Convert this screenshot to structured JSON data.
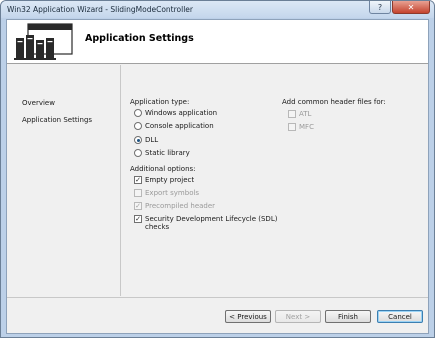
{
  "window": {
    "title": "Win32 Application Wizard - SlidingModeController",
    "help_glyph": "?",
    "close_glyph": "✕"
  },
  "banner": {
    "title": "Application Settings",
    "icon": "wizard-computers-icon"
  },
  "nav": {
    "items": [
      {
        "label": "Overview"
      },
      {
        "label": "Application Settings"
      }
    ]
  },
  "application_type": {
    "label": "Application type:",
    "options": [
      {
        "label": "Windows application",
        "selected": false
      },
      {
        "label": "Console application",
        "selected": false
      },
      {
        "label": "DLL",
        "selected": true
      },
      {
        "label": "Static library",
        "selected": false
      }
    ]
  },
  "additional_options": {
    "label": "Additional options:",
    "options": [
      {
        "label": "Empty project",
        "checked": true,
        "enabled": true
      },
      {
        "label": "Export symbols",
        "checked": false,
        "enabled": false
      },
      {
        "label": "Precompiled header",
        "checked": true,
        "enabled": false
      },
      {
        "label": "Security Development Lifecycle (SDL)",
        "label_line2": "checks",
        "checked": true,
        "enabled": true
      }
    ]
  },
  "common_headers": {
    "label": "Add common header files for:",
    "options": [
      {
        "label": "ATL",
        "checked": false,
        "enabled": false
      },
      {
        "label": "MFC",
        "checked": false,
        "enabled": false
      }
    ]
  },
  "buttons": {
    "previous": "< Previous",
    "next": "Next >",
    "finish": "Finish",
    "cancel": "Cancel"
  },
  "colors": {
    "frame": "#bcd0e8",
    "close_button": "#c4432e",
    "radio_dot": "#1c5180",
    "default_button_border": "#3c7fb1"
  }
}
